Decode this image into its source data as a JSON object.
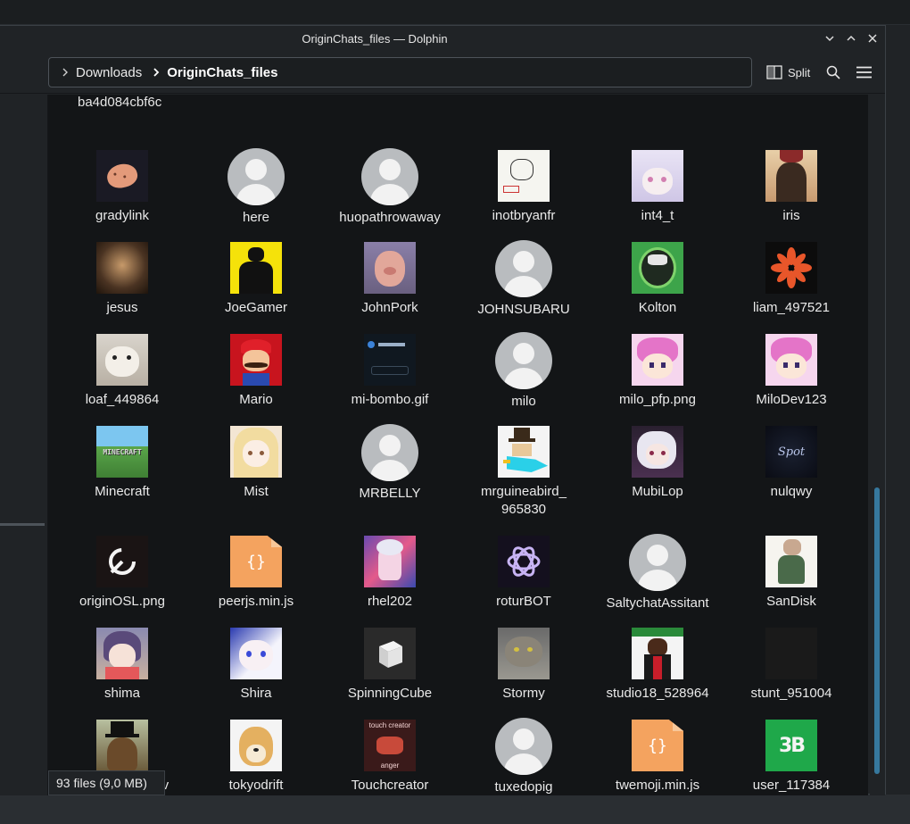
{
  "window": {
    "title": "OriginChats_files — Dolphin"
  },
  "breadcrumb": {
    "items": [
      "Downloads",
      "OriginChats_files"
    ]
  },
  "toolbar": {
    "split_label": "Split"
  },
  "view": {
    "partial_label": "ba4d084cbf6c",
    "files": [
      {
        "name": "gradylink",
        "kind": "image"
      },
      {
        "name": "here",
        "kind": "avatar"
      },
      {
        "name": "huopathrowaway",
        "kind": "avatar"
      },
      {
        "name": "inotbryanfr",
        "kind": "image"
      },
      {
        "name": "int4_t",
        "kind": "image"
      },
      {
        "name": "iris",
        "kind": "image"
      },
      {
        "name": "jesus",
        "kind": "image"
      },
      {
        "name": "JoeGamer",
        "kind": "image"
      },
      {
        "name": "JohnPork",
        "kind": "image"
      },
      {
        "name": "JOHNSUBARU",
        "kind": "avatar"
      },
      {
        "name": "Kolton",
        "kind": "image"
      },
      {
        "name": "liam_497521",
        "kind": "image"
      },
      {
        "name": "loaf_449864",
        "kind": "image"
      },
      {
        "name": "Mario",
        "kind": "image"
      },
      {
        "name": "mi-bombo.gif",
        "kind": "image"
      },
      {
        "name": "milo",
        "kind": "avatar"
      },
      {
        "name": "milo_pfp.png",
        "kind": "image"
      },
      {
        "name": "MiloDev123",
        "kind": "image"
      },
      {
        "name": "Minecraft",
        "kind": "image"
      },
      {
        "name": "Mist",
        "kind": "image"
      },
      {
        "name": "MRBELLY",
        "kind": "avatar"
      },
      {
        "name": "mrguineabird_ 965830",
        "kind": "image"
      },
      {
        "name": "MubiLop",
        "kind": "image"
      },
      {
        "name": "nulqwy",
        "kind": "image"
      },
      {
        "name": "originOSL.png",
        "kind": "image"
      },
      {
        "name": "peerjs.min.js",
        "kind": "script"
      },
      {
        "name": "rhel202",
        "kind": "image"
      },
      {
        "name": "roturBOT",
        "kind": "image"
      },
      {
        "name": "SaltychatAssitant",
        "kind": "avatar"
      },
      {
        "name": "SanDisk",
        "kind": "image"
      },
      {
        "name": "shima",
        "kind": "image"
      },
      {
        "name": "Shira",
        "kind": "image"
      },
      {
        "name": "SpinningCube",
        "kind": "image"
      },
      {
        "name": "Stormy",
        "kind": "image"
      },
      {
        "name": "studio18_528964",
        "kind": "image"
      },
      {
        "name": "stunt_951004",
        "kind": "image"
      },
      {
        "name": "ThatBeaverDev",
        "kind": "image"
      },
      {
        "name": "tokyodrift",
        "kind": "image"
      },
      {
        "name": "Touchcreator",
        "kind": "image"
      },
      {
        "name": "tuxedopig",
        "kind": "avatar"
      },
      {
        "name": "twemoji.min.js",
        "kind": "script"
      },
      {
        "name": "user_117384",
        "kind": "image"
      }
    ]
  },
  "status": {
    "summary": "93 files (9,0 MB)"
  },
  "thumbnail_text": {
    "minecraft": "MINECRAFT",
    "touchcreator_top": "touch creator",
    "touchcreator_bottom": "anger",
    "user_117384": "3B",
    "nulqwy": "Spot"
  }
}
